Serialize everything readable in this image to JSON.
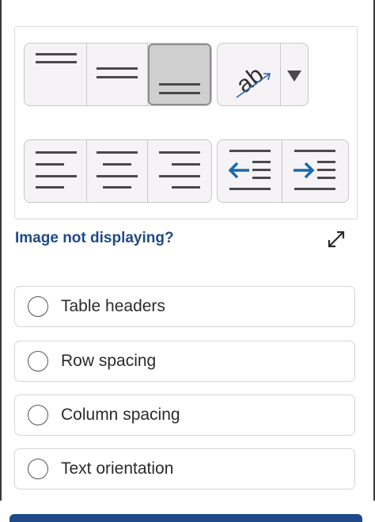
{
  "question_image": {
    "vertical_alignment_buttons": [
      {
        "name": "align-top",
        "selected": false
      },
      {
        "name": "align-middle",
        "selected": false
      },
      {
        "name": "align-bottom",
        "selected": true
      }
    ],
    "text_orientation_button": {
      "glyph": "ab",
      "dropdown": "chevron-down-icon"
    },
    "horizontal_alignment_buttons": [
      "align-left",
      "align-center",
      "align-right"
    ],
    "indent_buttons": [
      "decrease-indent",
      "increase-indent"
    ]
  },
  "image_help_link": "Image not displaying?",
  "options": [
    {
      "label": "Table headers"
    },
    {
      "label": "Row spacing"
    },
    {
      "label": "Column spacing"
    },
    {
      "label": "Text orientation"
    }
  ],
  "colors": {
    "link": "#1f4a87",
    "arrow": "#1569b0",
    "selected_cell": "#cfcfcf"
  }
}
